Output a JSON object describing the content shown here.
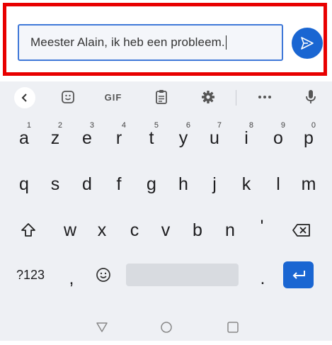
{
  "compose": {
    "message_text": "Meester Alain, ik heb een probleem.",
    "highlight_color": "#e80000",
    "accent_color": "#1a66d2",
    "send_icon": "send-icon"
  },
  "keyboard": {
    "toolbar": {
      "gif_label": "GIF",
      "icons": [
        "chevron-left-icon",
        "sticker-icon",
        "gif-icon",
        "clipboard-icon",
        "gear-icon",
        "more-icon",
        "microphone-icon"
      ]
    },
    "row1": [
      {
        "ch": "a",
        "num": "1"
      },
      {
        "ch": "z",
        "num": "2"
      },
      {
        "ch": "e",
        "num": "3"
      },
      {
        "ch": "r",
        "num": "4"
      },
      {
        "ch": "t",
        "num": "5"
      },
      {
        "ch": "y",
        "num": "6"
      },
      {
        "ch": "u",
        "num": "7"
      },
      {
        "ch": "i",
        "num": "8"
      },
      {
        "ch": "o",
        "num": "9"
      },
      {
        "ch": "p",
        "num": "0"
      }
    ],
    "row2": [
      "q",
      "s",
      "d",
      "f",
      "g",
      "h",
      "j",
      "k",
      "l",
      "m"
    ],
    "row3": [
      "w",
      "x",
      "c",
      "v",
      "b",
      "n",
      "'"
    ],
    "row4": {
      "symbols_label": "?123",
      "comma": ",",
      "period": "."
    }
  }
}
